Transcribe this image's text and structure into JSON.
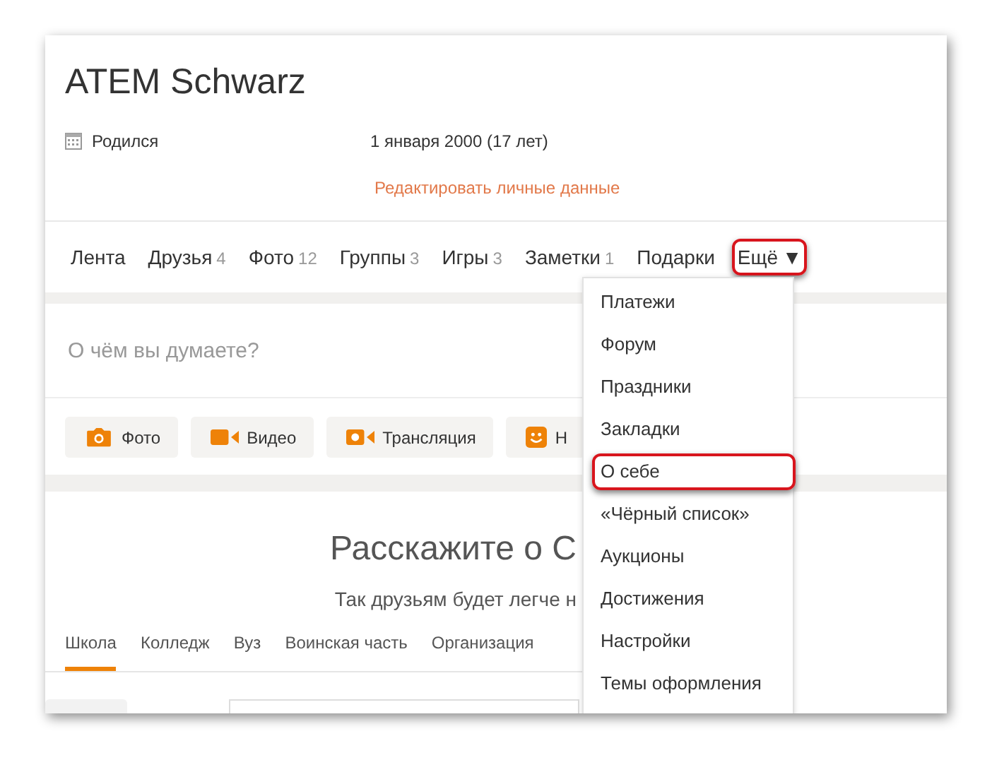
{
  "profile": {
    "name": "ATEM Schwarz",
    "born_label": "Родился",
    "born_value": "1 января 2000 (17 лет)",
    "edit_link": "Редактировать личные данные"
  },
  "nav": [
    {
      "label": "Лента",
      "highlighted": false
    },
    {
      "label": "Друзья",
      "count": "4",
      "highlighted": false
    },
    {
      "label": "Фото",
      "count": "12",
      "highlighted": false
    },
    {
      "label": "Группы",
      "count": "3",
      "highlighted": false
    },
    {
      "label": "Игры",
      "count": "3",
      "highlighted": false
    },
    {
      "label": "Заметки",
      "count": "1",
      "highlighted": false
    },
    {
      "label": "Подарки",
      "highlighted": false
    },
    {
      "label": "Ещё",
      "caret": "▼",
      "highlighted": true
    }
  ],
  "post": {
    "placeholder": "О чём вы думаете?",
    "buttons": [
      {
        "kind": "photo",
        "label": "Фото"
      },
      {
        "kind": "video",
        "label": "Видео"
      },
      {
        "kind": "live",
        "label": "Трансляция"
      },
      {
        "kind": "smile",
        "label": "Н"
      }
    ]
  },
  "about": {
    "heading": "Расскажите о С",
    "subtitle": "Так друзьям будет легче н",
    "tabs": [
      {
        "label": "Школа",
        "selected": true
      },
      {
        "label": "Колледж",
        "selected": false
      },
      {
        "label": "Вуз",
        "selected": false
      },
      {
        "label": "Воинская часть",
        "selected": false
      },
      {
        "label": "Организация",
        "selected": false
      }
    ]
  },
  "menu": [
    {
      "label": "Платежи",
      "highlighted": false
    },
    {
      "label": "Форум",
      "highlighted": false
    },
    {
      "label": "Праздники",
      "highlighted": false
    },
    {
      "label": "Закладки",
      "highlighted": false
    },
    {
      "label": "О себе",
      "highlighted": true
    },
    {
      "label": "«Чёрный список»",
      "highlighted": false
    },
    {
      "label": "Аукционы",
      "highlighted": false
    },
    {
      "label": "Достижения",
      "highlighted": false
    },
    {
      "label": "Настройки",
      "highlighted": false
    },
    {
      "label": "Темы оформления",
      "highlighted": false
    }
  ]
}
